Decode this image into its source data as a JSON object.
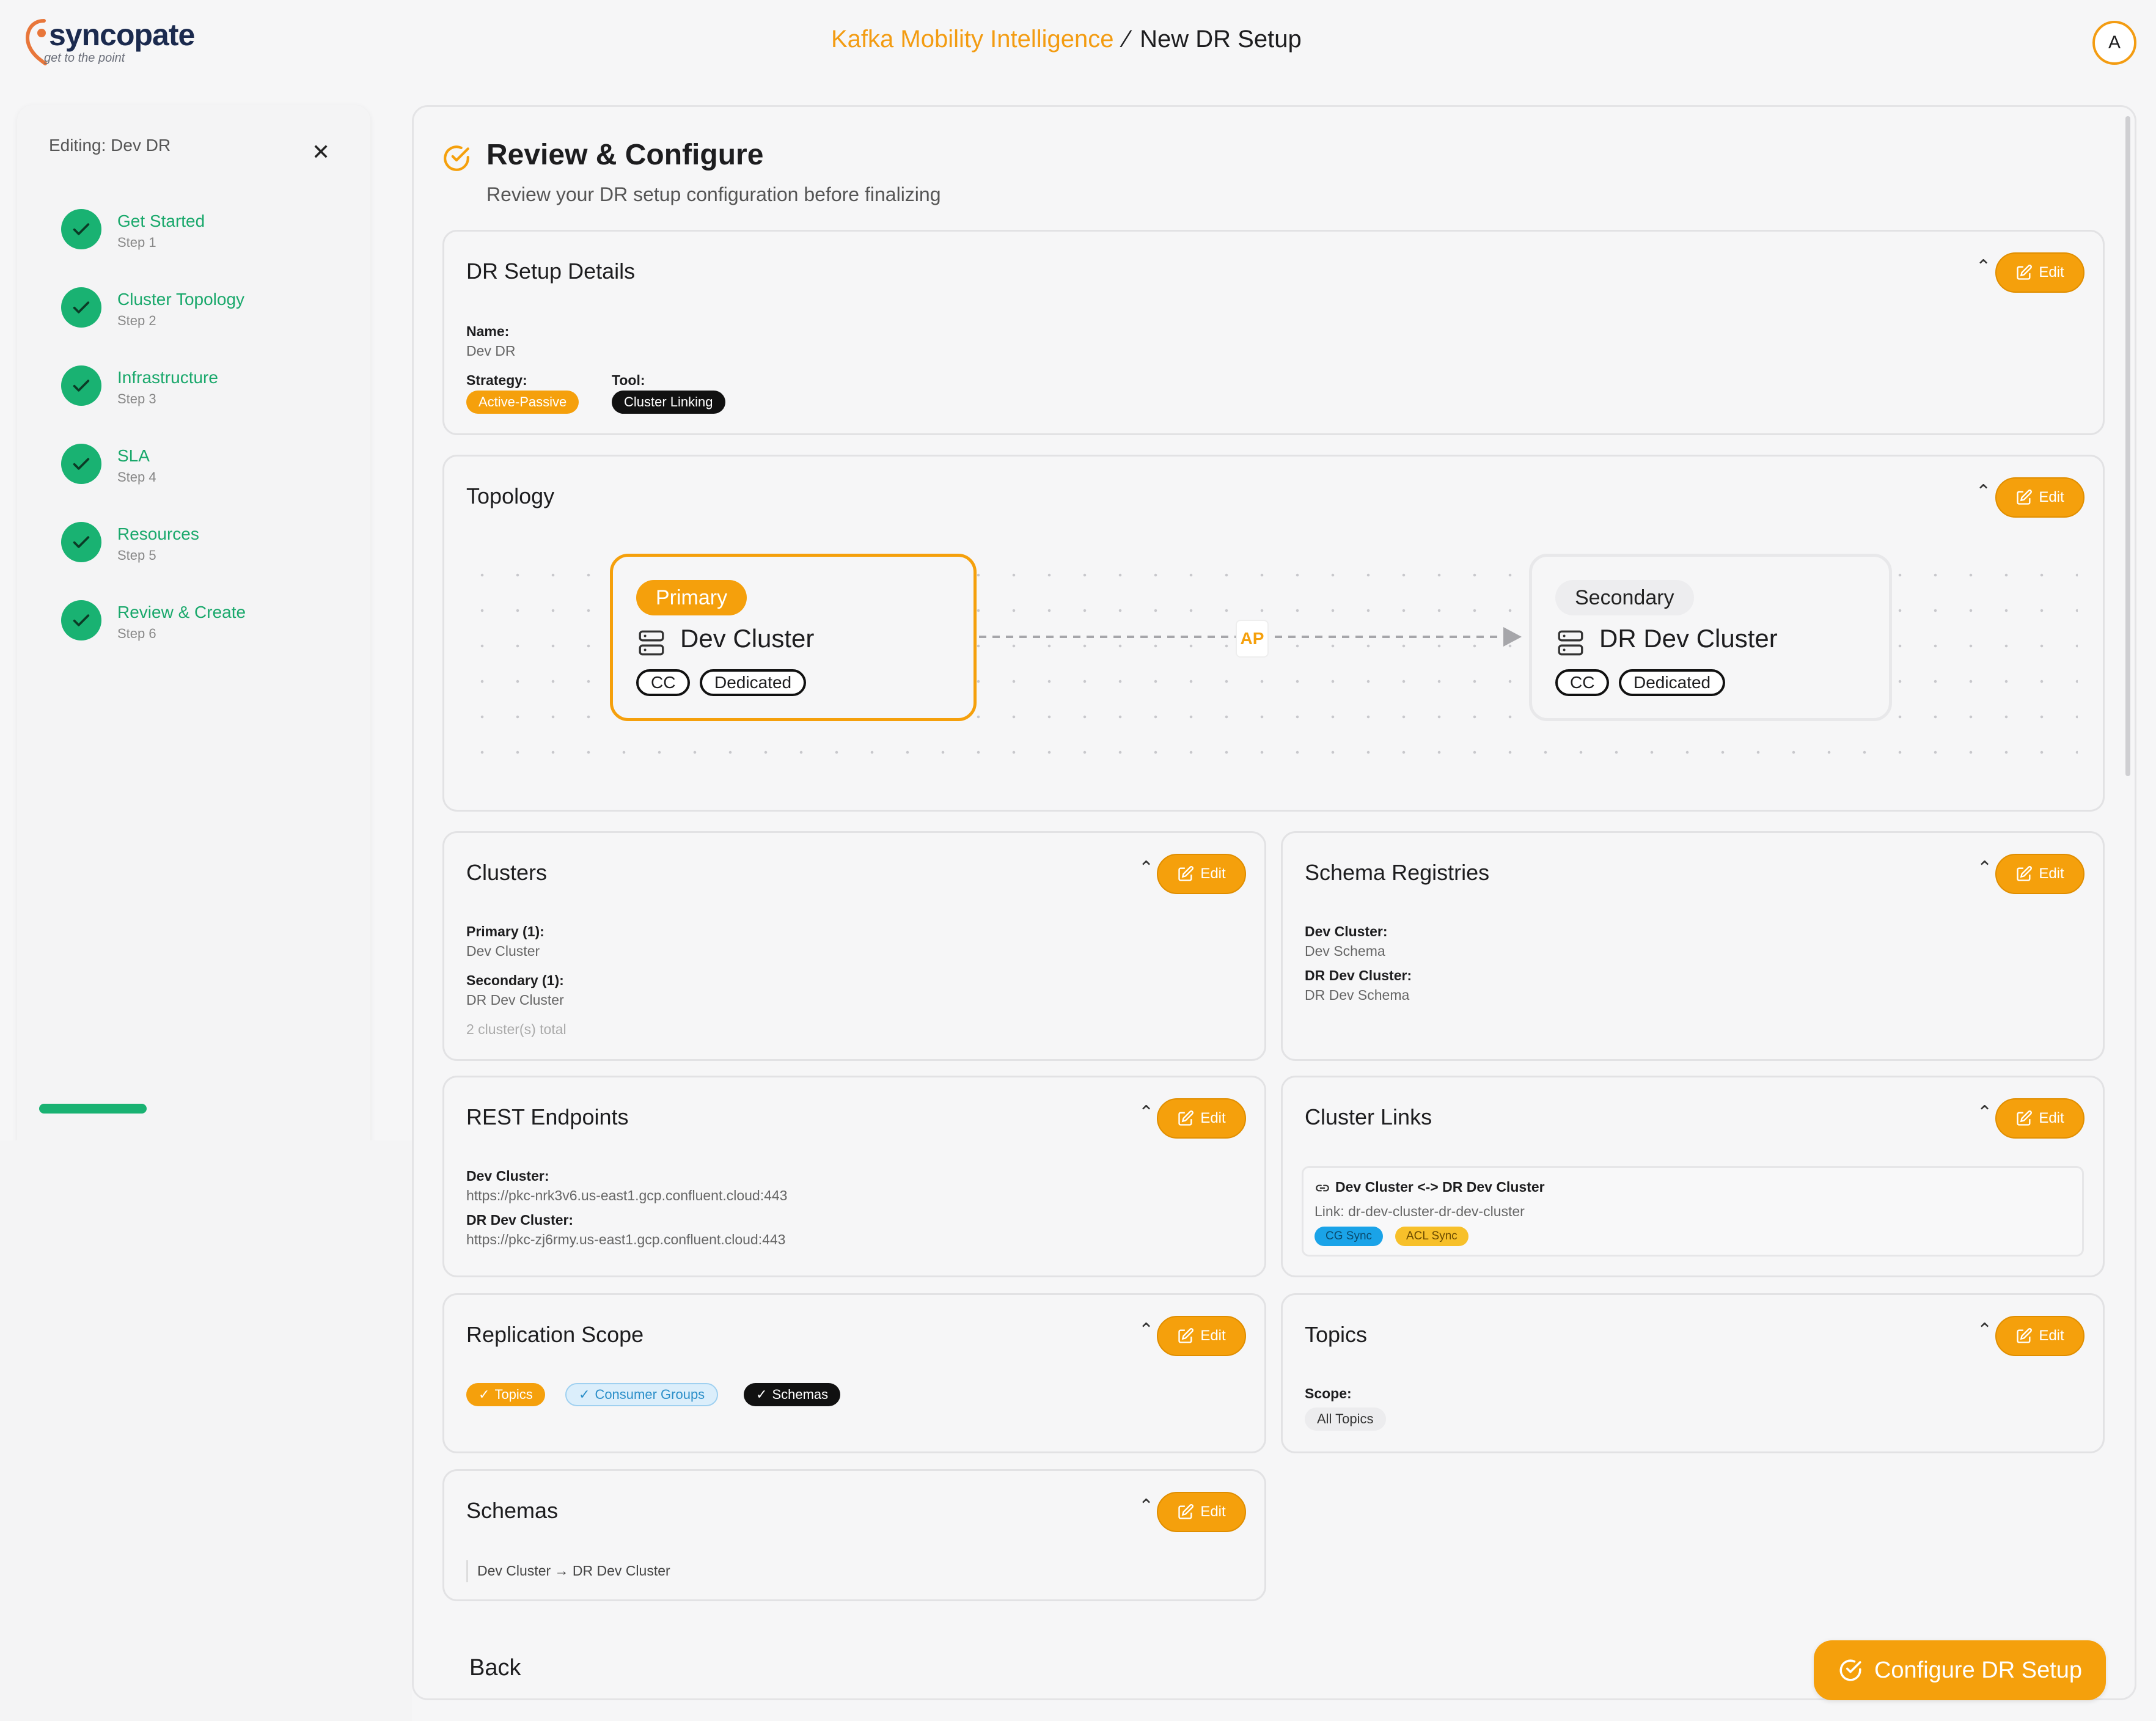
{
  "app": {
    "logo_text": "syncopate",
    "logo_tagline": "get to the point",
    "brand_title": "Kafka Mobility Intelligence",
    "page_crumb": "New DR Setup",
    "avatar_initial": "A",
    "accent_color": "#f5a00c",
    "success_color": "#19b272"
  },
  "sidebar": {
    "editing_label": "Editing: Dev DR",
    "steps": [
      {
        "label": "Get Started",
        "sub": "Step 1"
      },
      {
        "label": "Cluster Topology",
        "sub": "Step 2"
      },
      {
        "label": "Infrastructure",
        "sub": "Step 3"
      },
      {
        "label": "SLA",
        "sub": "Step 4"
      },
      {
        "label": "Resources",
        "sub": "Step 5"
      },
      {
        "label": "Review & Create",
        "sub": "Step 6"
      }
    ]
  },
  "main": {
    "title": "Review & Configure",
    "subtitle": "Review your DR setup configuration before finalizing",
    "edit_label": "Edit",
    "details": {
      "title": "DR Setup Details",
      "name_label": "Name:",
      "name_value": "Dev DR",
      "strategy_label": "Strategy:",
      "strategy_value": "Active-Passive",
      "tool_label": "Tool:",
      "tool_value": "Cluster Linking"
    },
    "topology": {
      "title": "Topology",
      "primary_role": "Primary",
      "primary_name": "Dev Cluster",
      "primary_tags": [
        "CC",
        "Dedicated"
      ],
      "link_label": "AP",
      "secondary_role": "Secondary",
      "secondary_name": "DR Dev Cluster",
      "secondary_tags": [
        "CC",
        "Dedicated"
      ]
    },
    "clusters": {
      "title": "Clusters",
      "primary_label": "Primary (1):",
      "primary_value": "Dev Cluster",
      "secondary_label": "Secondary (1):",
      "secondary_value": "DR Dev Cluster",
      "total": "2 cluster(s) total"
    },
    "schema_registries": {
      "title": "Schema Registries",
      "a_label": "Dev Cluster:",
      "a_value": "Dev Schema",
      "b_label": "DR Dev Cluster:",
      "b_value": "DR Dev Schema"
    },
    "rest": {
      "title": "REST Endpoints",
      "a_label": "Dev Cluster:",
      "a_value": "https://pkc-nrk3v6.us-east1.gcp.confluent.cloud:443",
      "b_label": "DR Dev Cluster:",
      "b_value": "https://pkc-zj6rmy.us-east1.gcp.confluent.cloud:443"
    },
    "cluster_links": {
      "title": "Cluster Links",
      "link_title": "Dev Cluster <-> DR Dev Cluster",
      "link_name": "Link: dr-dev-cluster-dr-dev-cluster",
      "badge_cg": "CG Sync",
      "badge_acl": "ACL Sync"
    },
    "replication": {
      "title": "Replication Scope",
      "topics": "Topics",
      "consumer_groups": "Consumer Groups",
      "schemas": "Schemas"
    },
    "topics": {
      "title": "Topics",
      "scope_label": "Scope:",
      "scope_value": "All Topics"
    },
    "schemas": {
      "title": "Schemas",
      "mapping": "Dev Cluster → DR Dev Cluster"
    },
    "back_label": "Back",
    "configure_label": "Configure DR Setup"
  }
}
